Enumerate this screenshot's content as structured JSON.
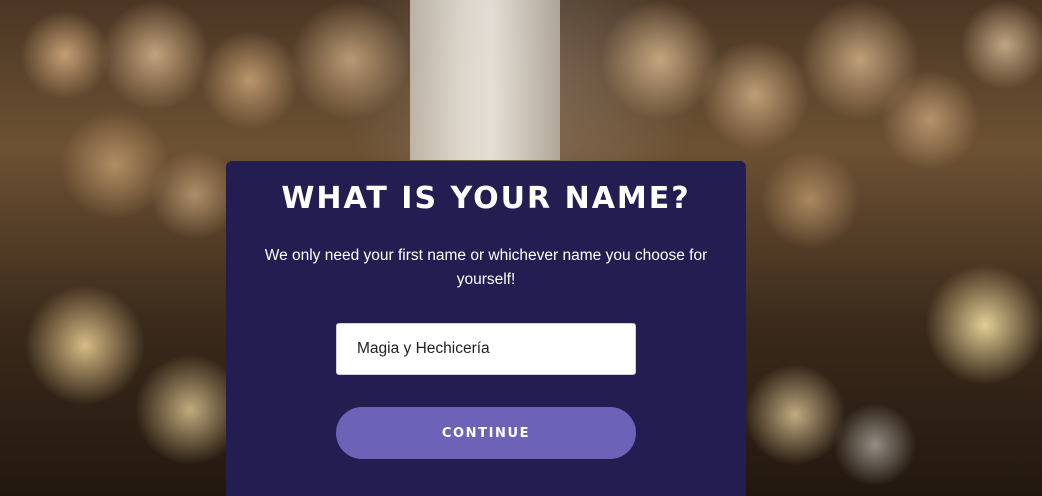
{
  "dialog": {
    "title": "What is your name?",
    "subtitle": "We only need your first name or whichever name you choose for yourself!",
    "name_input": {
      "value": "Magia y Hechicería",
      "placeholder": ""
    },
    "continue_label": "CONTINUE"
  },
  "colors": {
    "panel": "#231d52",
    "button": "#6c63b8",
    "text": "#ffffff"
  }
}
